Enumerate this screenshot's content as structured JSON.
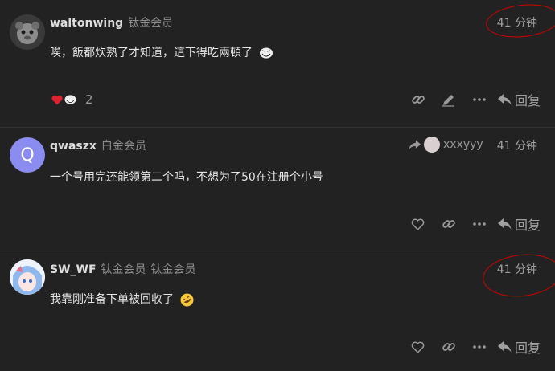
{
  "posts": [
    {
      "username": "waltonwing",
      "titles": [
        "钛金会员"
      ],
      "time": "41 分钟",
      "body": "唉，飯都炊熟了才知道，這下得吃兩頓了",
      "reaction_count": "2",
      "reply_label": "回复"
    },
    {
      "username": "qwaszx",
      "titles": [
        "白金会员"
      ],
      "time": "41 分钟",
      "avatar_letter": "Q",
      "reply_to": "xxxyyy",
      "body": "一个号用完还能领第二个吗，不想为了50在注册个小号",
      "reply_label": "回复"
    },
    {
      "username": "SW_WF",
      "titles": [
        "钛金会员",
        "钛金会员"
      ],
      "time": "41 分钟",
      "body": "我靠刚准备下单被回收了",
      "reply_label": "回复"
    }
  ],
  "colors": {
    "background": "#222222",
    "avatar_q": "#8a8cf0",
    "annotation": "#d60000",
    "heart": "#e0202f"
  },
  "icons": [
    "heart-icon",
    "troll-emoji",
    "link-icon",
    "pencil-icon",
    "ellipsis-icon",
    "reply-icon",
    "share-arrow-icon",
    "rofl-emoji"
  ]
}
